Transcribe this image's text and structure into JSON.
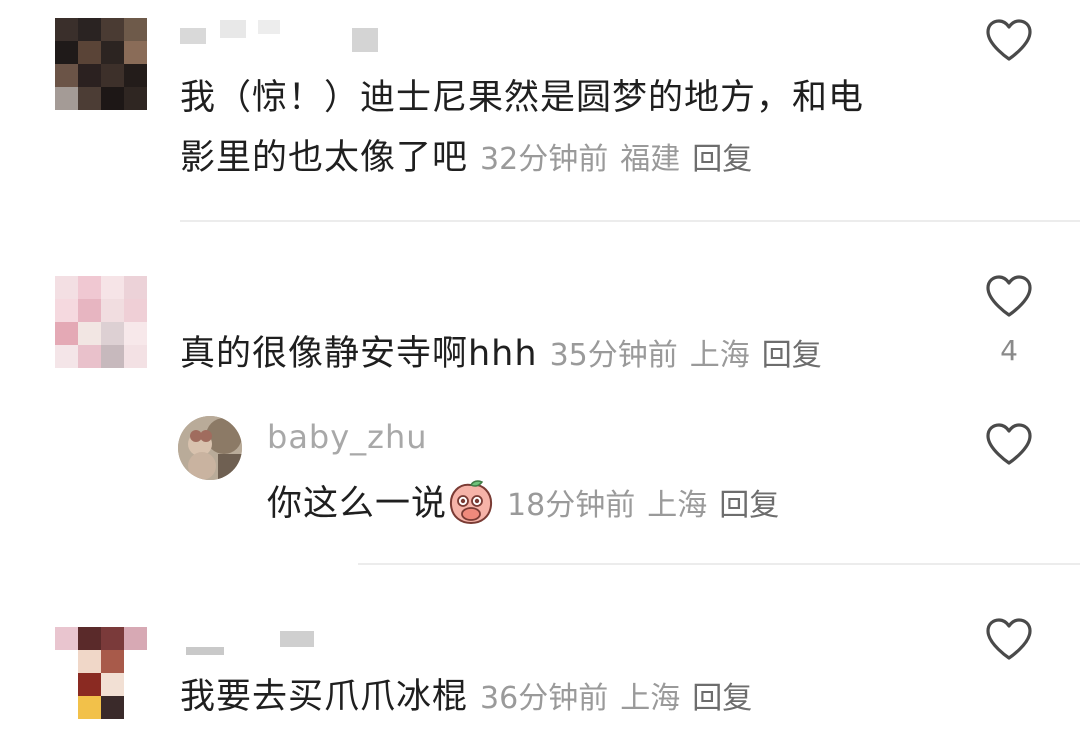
{
  "comments": [
    {
      "text_line1": "我（惊！）迪士尼果然是圆梦的地方，和电",
      "text_line2": "影里的也太像了吧",
      "time": "32分钟前",
      "location": "福建",
      "reply_label": "回复"
    },
    {
      "text": "真的很像静安寺啊hhh",
      "time": "35分钟前",
      "location": "上海",
      "reply_label": "回复",
      "like_count": "4",
      "replies": [
        {
          "username": "baby_zhu",
          "text": "你这么一说",
          "emoji": "peach-covering-mouth-emoji",
          "time": "18分钟前",
          "location": "上海",
          "reply_label": "回复"
        }
      ]
    },
    {
      "text": "我要去买爪爪冰棍",
      "time": "36分钟前",
      "location": "上海",
      "reply_label": "回复"
    }
  ],
  "icons": {
    "like": "heart-outline-icon"
  },
  "colors": {
    "meta_gray": "#9a9a9a",
    "heart_stroke": "#4a4a4a",
    "divider": "#ececec"
  }
}
